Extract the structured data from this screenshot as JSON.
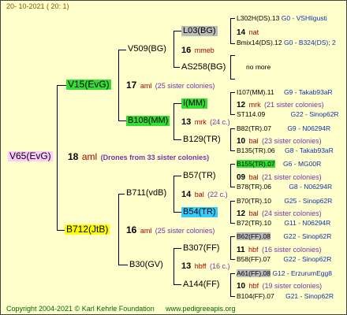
{
  "header": {
    "date": "20-  10-2021  (  20:   1)"
  },
  "root": {
    "name": "V65(EvG)",
    "num": "18",
    "unit": "aml",
    "note": "(Drones from 33 sister colonies)"
  },
  "gen1": [
    {
      "name": "V15(EvG)",
      "num": "17",
      "unit": "aml",
      "note": "(25 sister colonies)"
    },
    {
      "name": "B712(JtB)",
      "num": "16",
      "unit": "aml",
      "note": "(25 sister colonies)"
    }
  ],
  "gen2": [
    {
      "name": "V509(BG)"
    },
    {
      "name": "B108(MM)",
      "num": "13",
      "unit": "mrk",
      "note": "(24 c.)"
    },
    {
      "name": "B711(vdB)",
      "num": "14",
      "unit": "bal",
      "note": "(22 c.)"
    },
    {
      "name": "B30(GV)",
      "num": "13",
      "unit": "hbff",
      "note": "(16 c.)"
    }
  ],
  "gen3": [
    {
      "name": "L03(BG)",
      "num": "16",
      "unit": "mmeb"
    },
    {
      "name": "AS258(BG)"
    },
    {
      "name": "I(MM)",
      "num": "12",
      "unit": "mrk",
      "note": "(21 sister colonies)"
    },
    {
      "name": "B129(TR)",
      "num": "10",
      "unit": "bal",
      "note": "(23 sister colonies)"
    },
    {
      "name": "B57(TR)",
      "num": "09",
      "unit": "bal",
      "note": "(21 sister colonies)"
    },
    {
      "name": "B54(TR)",
      "num": "12",
      "unit": "bal",
      "note": "(24 sister colonies)"
    },
    {
      "name": "B307(FF)",
      "num": "11",
      "unit": "hbf",
      "note": "(16 sister colonies)"
    },
    {
      "name": "A144(FF)",
      "num": "10",
      "unit": "hbf",
      "note": "(19 sister colonies)"
    }
  ],
  "gen4": {
    "r01": {
      "name": "L302H(DS).13",
      "ref": "G0 - VSHligusti"
    },
    "r02": {
      "num": "14",
      "unit": "nat"
    },
    "r03": {
      "name": "Bmix14(DS).12",
      "ref": "G0 - B324(DS); 2"
    },
    "r04": {
      "name": "no more"
    },
    "r05": {
      "name": "I107(MM).11",
      "ref": "G9 - Takab93aR"
    },
    "r06": {
      "name": "ST114.09",
      "ref": "G22 - Sinop62R"
    },
    "r07": {
      "name": "B82(TR).07",
      "ref": "G9 - N06294R"
    },
    "r08": {
      "name": "B135(TR).06",
      "ref": "G8 - Takab93aR"
    },
    "r09": {
      "name": "B155(TR).07",
      "ref": "G6 - MG00R"
    },
    "r10": {
      "name": "B78(TR).06",
      "ref": "G8 - N06294R"
    },
    "r11": {
      "name": "B70(TR).10",
      "ref": "G25 - Sinop62R"
    },
    "r12": {
      "name": "B72(TR).10",
      "ref": "G11 - N06294R"
    },
    "r13": {
      "name": "B62(FF).08",
      "ref": "G22 - Sinop62R"
    },
    "r14": {
      "name": "B58(FF).07",
      "ref": "G22 - Sinop62R"
    },
    "r15": {
      "name": "A61(FF).08",
      "ref": "G12 - ErzurumEgg8"
    },
    "r16": {
      "name": "B104(FF).07",
      "ref": "G21 - Sinop62R"
    }
  },
  "footer": {
    "copyright": "Copyright 2004-2021 © Karl Kehrle Foundation",
    "url": "www.pedigreeapis.org"
  }
}
